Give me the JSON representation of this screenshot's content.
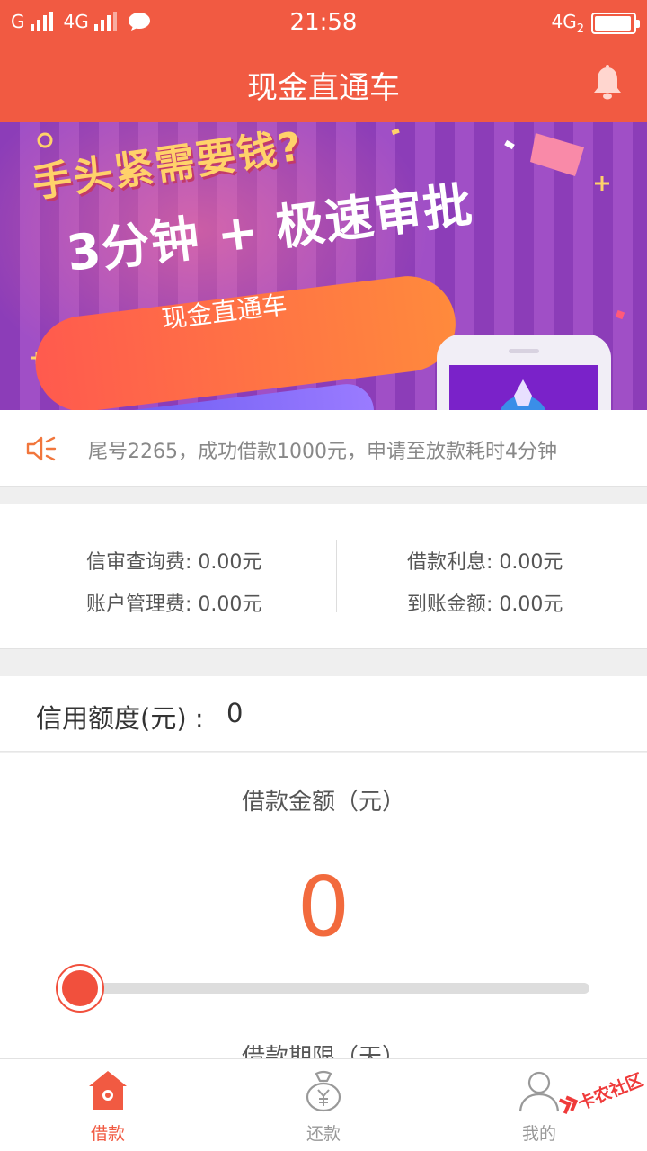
{
  "status_bar": {
    "carrier1": "G",
    "carrier2": "4G",
    "time": "21:58",
    "network_right": "4G",
    "sim_index": "2"
  },
  "header": {
    "title": "现金直通车",
    "bell_icon": "bell-icon"
  },
  "banner": {
    "headline": "手头紧需要钱?",
    "pill_text": "3分钟 + 极速审批",
    "brand": "现金直通车",
    "pages": 2,
    "active_page": 1
  },
  "notice": {
    "icon": "speaker-icon",
    "text": "尾号2265，成功借款1000元，申请至放款耗时4分钟"
  },
  "fees": {
    "credit_check": "信审查询费: 0.00元",
    "interest": "借款利息: 0.00元",
    "account_mgmt": "账户管理费: 0.00元",
    "received": "到账金额: 0.00元"
  },
  "credit": {
    "label": "信用额度(元) :",
    "value": "0"
  },
  "loan": {
    "amount_label": "借款金额（元）",
    "amount_value": "0",
    "slider_level": 0,
    "term_label": "借款期限（天）"
  },
  "tabbar": {
    "tabs": [
      {
        "label": "借款",
        "icon": "house-icon",
        "active": true
      },
      {
        "label": "还款",
        "icon": "money-bag-icon",
        "active": false
      },
      {
        "label": "我的",
        "icon": "user-icon",
        "active": false
      }
    ]
  },
  "watermark": {
    "text": "卡农社区"
  },
  "colors": {
    "accent": "#f15a42",
    "amount": "#f26a3d",
    "banner_purple": "#8c3db8"
  }
}
